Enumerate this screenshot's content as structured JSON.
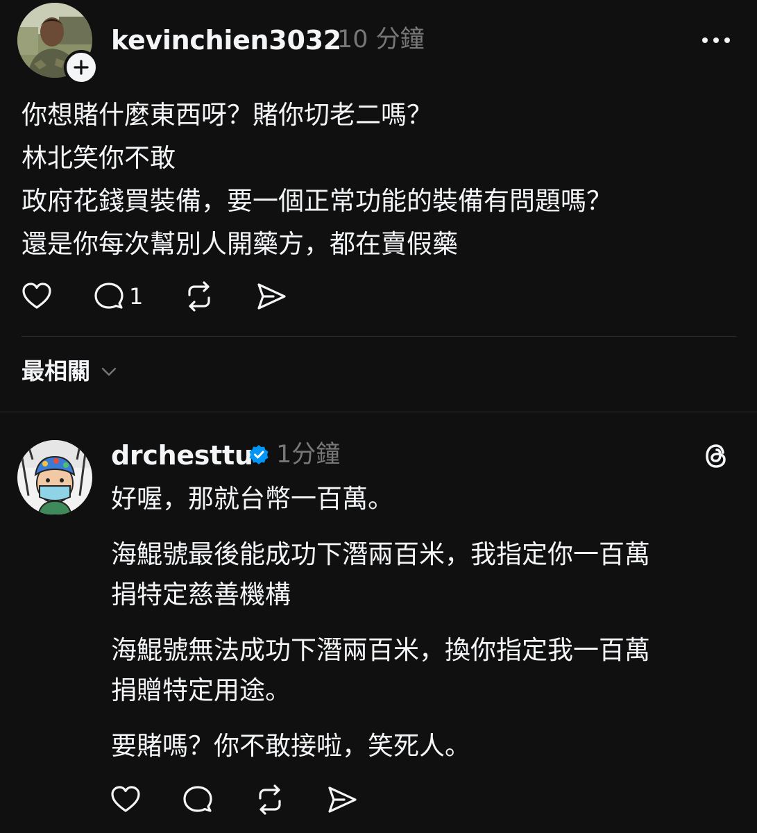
{
  "post": {
    "username": "kevinchien3032",
    "time": "10 分鐘",
    "more_icon": "more-horizontal-icon",
    "lines": [
      "你想賭什麼東西呀？賭你切老二嗎？",
      "林北笑你不敢",
      "政府花錢買裝備，要一個正常功能的裝備有問題嗎？",
      "還是你每次幫別人開藥方，都在賣假藥"
    ],
    "actions": {
      "like_icon": "heart-icon",
      "comment_icon": "comment-icon",
      "comment_count": "1",
      "repost_icon": "repost-icon",
      "share_icon": "share-icon"
    }
  },
  "sort": {
    "label": "最相關",
    "icon": "chevron-down-icon"
  },
  "reply": {
    "username": "drchesttu",
    "verified": true,
    "time": "1分鐘",
    "paragraphs": [
      [
        "好喔，那就台幣一百萬。"
      ],
      [
        "海鯤號最後能成功下潛兩百米，我指定你一百萬",
        "捐特定慈善機構"
      ],
      [
        "海鯤號無法成功下潛兩百米，換你指定我一百萬",
        "捐贈特定用途。"
      ],
      [
        "要賭嗎？你不敢接啦，笑死人。"
      ]
    ]
  },
  "colors": {
    "background": "#101010",
    "text": "#f3f5f7",
    "secondary": "#777777",
    "divider": "#2f2f2f",
    "verified": "#0095f6"
  }
}
